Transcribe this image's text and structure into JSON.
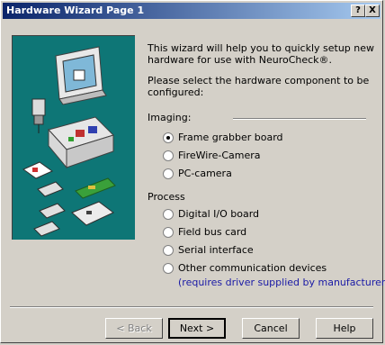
{
  "window": {
    "title": "Hardware Wizard Page 1",
    "help_glyph": "?",
    "close_glyph": "X"
  },
  "intro": {
    "line1": "This wizard will help you to quickly setup new",
    "line2": "hardware for use with NeuroCheck®.",
    "select_line1": "Please select the hardware component to be",
    "select_line2": "configured:"
  },
  "imaging": {
    "header": "Imaging:",
    "options": [
      {
        "label": "Frame grabber board",
        "checked": true
      },
      {
        "label": "FireWire-Camera",
        "checked": false
      },
      {
        "label": "PC-camera",
        "checked": false
      }
    ]
  },
  "process": {
    "header": "Process",
    "options": [
      {
        "label": "Digital I/O board",
        "checked": false
      },
      {
        "label": "Field bus card",
        "checked": false
      },
      {
        "label": "Serial interface",
        "checked": false
      },
      {
        "label": "Other communication devices",
        "checked": false
      }
    ],
    "note": "(requires driver supplied by manufacturer)"
  },
  "buttons": {
    "back": "< Back",
    "next": "Next >",
    "cancel": "Cancel",
    "help": "Help"
  },
  "colors": {
    "title_gradient_start": "#0a246a",
    "title_gradient_end": "#a6caf0",
    "art_background": "#0e7676",
    "note_text": "#1a1aa6"
  }
}
